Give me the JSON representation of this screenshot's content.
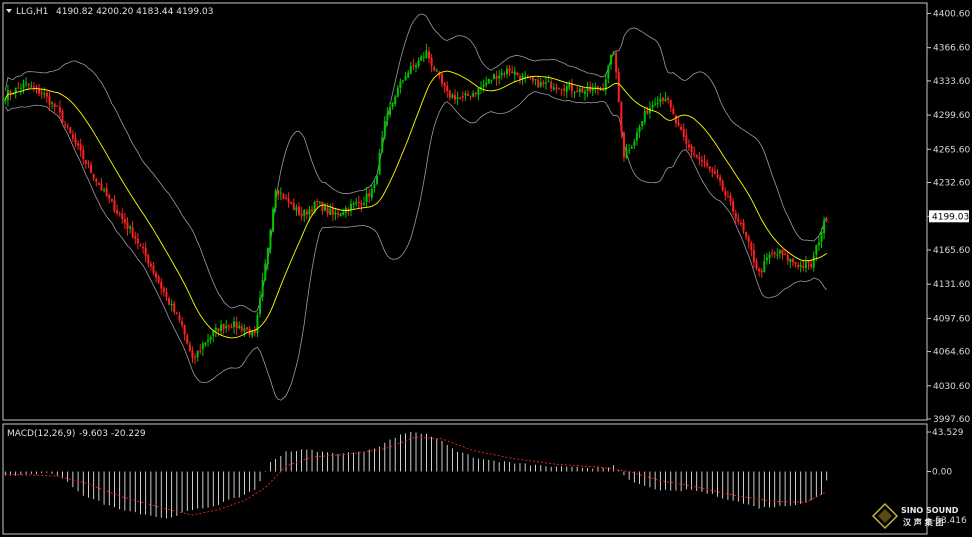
{
  "header": {
    "symbol": "LLG,H1",
    "ohlc": "4190.82 4200.20 4183.44 4199.03"
  },
  "macd_header": {
    "label": "MACD(12,26,9)",
    "values": "-9.603 -20.229"
  },
  "price_axis": {
    "ticks": [
      "4400.60",
      "4366.60",
      "4333.60",
      "4299.60",
      "4265.60",
      "4232.60",
      "4199.03",
      "4165.60",
      "4131.60",
      "4097.60",
      "4064.60",
      "4030.60",
      "3997.60"
    ],
    "tick_values": [
      4400.6,
      4366.6,
      4333.6,
      4299.6,
      4265.6,
      4232.6,
      4199.03,
      4165.6,
      4131.6,
      4097.6,
      4064.6,
      4030.6,
      3997.6
    ],
    "current_price": "4199.03"
  },
  "macd_axis": {
    "ticks": [
      "43.529",
      "0.00",
      "-53.416"
    ],
    "tick_values": [
      43.529,
      0,
      -53.416
    ]
  },
  "logo": {
    "line1": "SINO SOUND",
    "line2": "汉 声 集 团"
  },
  "colors": {
    "bull": "#00c400",
    "bear": "#ff2020",
    "ma": "#ffff00",
    "bands": "#9a9aa8",
    "macd_hist": "#ffffff",
    "signal": "#ff2020",
    "grid_frame": "#c8c8c8"
  },
  "chart_data": [
    {
      "type": "candlestick",
      "title": "LLG,H1",
      "price_range": [
        3997.6,
        4410
      ],
      "indicators": [
        "Bollinger Bands",
        "Moving Average (yellow)"
      ],
      "close_path": [
        [
          0,
          4320
        ],
        [
          8,
          4330
        ],
        [
          14,
          4322
        ],
        [
          20,
          4305
        ],
        [
          26,
          4275
        ],
        [
          32,
          4248
        ],
        [
          38,
          4222
        ],
        [
          44,
          4200
        ],
        [
          50,
          4178
        ],
        [
          56,
          4150
        ],
        [
          62,
          4118
        ],
        [
          68,
          4090
        ],
        [
          72,
          4055
        ],
        [
          76,
          4072
        ],
        [
          82,
          4088
        ],
        [
          86,
          4092
        ],
        [
          92,
          4088
        ],
        [
          96,
          4080
        ],
        [
          100,
          4150
        ],
        [
          104,
          4228
        ],
        [
          108,
          4215
        ],
        [
          114,
          4200
        ],
        [
          120,
          4212
        ],
        [
          126,
          4200
        ],
        [
          132,
          4208
        ],
        [
          138,
          4215
        ],
        [
          142,
          4228
        ],
        [
          146,
          4290
        ],
        [
          150,
          4320
        ],
        [
          154,
          4340
        ],
        [
          158,
          4350
        ],
        [
          162,
          4362
        ],
        [
          166,
          4340
        ],
        [
          170,
          4320
        ],
        [
          176,
          4316
        ],
        [
          182,
          4325
        ],
        [
          188,
          4338
        ],
        [
          194,
          4345
        ],
        [
          200,
          4335
        ],
        [
          206,
          4330
        ],
        [
          212,
          4330
        ],
        [
          218,
          4326
        ],
        [
          224,
          4323
        ],
        [
          230,
          4328
        ],
        [
          234,
          4365
        ],
        [
          238,
          4260
        ],
        [
          242,
          4275
        ],
        [
          246,
          4300
        ],
        [
          250,
          4315
        ],
        [
          254,
          4318
        ],
        [
          258,
          4292
        ],
        [
          262,
          4270
        ],
        [
          266,
          4258
        ],
        [
          270,
          4248
        ],
        [
          274,
          4235
        ],
        [
          278,
          4215
        ],
        [
          282,
          4195
        ],
        [
          286,
          4170
        ],
        [
          290,
          4142
        ],
        [
          294,
          4160
        ],
        [
          298,
          4162
        ],
        [
          302,
          4155
        ],
        [
          306,
          4150
        ],
        [
          310,
          4150
        ],
        [
          314,
          4185
        ],
        [
          316,
          4199
        ]
      ]
    },
    {
      "type": "bar",
      "title": "MACD(12,26,9)",
      "series": [
        {
          "name": "MACD",
          "last": -9.603
        },
        {
          "name": "Signal",
          "last": -20.229
        }
      ],
      "ylim": [
        -53.416,
        43.529
      ],
      "macd_path": [
        [
          0,
          -5
        ],
        [
          10,
          -3
        ],
        [
          18,
          -2
        ],
        [
          24,
          -12
        ],
        [
          30,
          -26
        ],
        [
          40,
          -38
        ],
        [
          50,
          -45
        ],
        [
          62,
          -52
        ],
        [
          70,
          -44
        ],
        [
          80,
          -38
        ],
        [
          90,
          -28
        ],
        [
          96,
          -20
        ],
        [
          102,
          10
        ],
        [
          108,
          22
        ],
        [
          116,
          24
        ],
        [
          126,
          20
        ],
        [
          136,
          21
        ],
        [
          144,
          28
        ],
        [
          150,
          38
        ],
        [
          156,
          44
        ],
        [
          162,
          41
        ],
        [
          168,
          34
        ],
        [
          174,
          22
        ],
        [
          182,
          14
        ],
        [
          190,
          11
        ],
        [
          200,
          8
        ],
        [
          212,
          5
        ],
        [
          226,
          4
        ],
        [
          234,
          6
        ],
        [
          240,
          -10
        ],
        [
          248,
          -18
        ],
        [
          256,
          -22
        ],
        [
          264,
          -20
        ],
        [
          270,
          -24
        ],
        [
          280,
          -32
        ],
        [
          290,
          -40
        ],
        [
          300,
          -38
        ],
        [
          308,
          -34
        ],
        [
          314,
          -26
        ],
        [
          316,
          -10
        ]
      ],
      "signal_path": [
        [
          0,
          -3
        ],
        [
          20,
          -5
        ],
        [
          30,
          -12
        ],
        [
          45,
          -28
        ],
        [
          60,
          -40
        ],
        [
          72,
          -48
        ],
        [
          82,
          -42
        ],
        [
          92,
          -32
        ],
        [
          100,
          -18
        ],
        [
          108,
          6
        ],
        [
          118,
          16
        ],
        [
          132,
          19
        ],
        [
          146,
          25
        ],
        [
          158,
          38
        ],
        [
          168,
          36
        ],
        [
          180,
          23
        ],
        [
          196,
          14
        ],
        [
          212,
          8
        ],
        [
          228,
          5
        ],
        [
          240,
          0
        ],
        [
          252,
          -10
        ],
        [
          264,
          -16
        ],
        [
          280,
          -26
        ],
        [
          296,
          -33
        ],
        [
          308,
          -34
        ],
        [
          316,
          -22
        ]
      ]
    }
  ]
}
